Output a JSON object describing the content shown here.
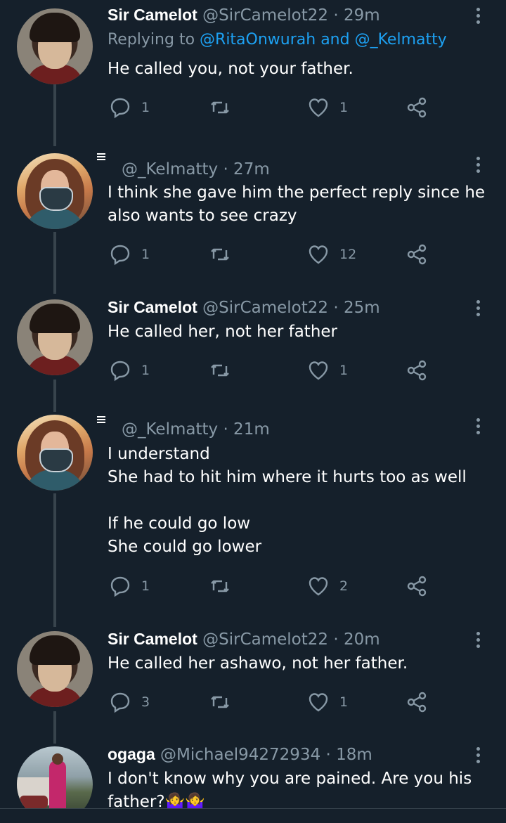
{
  "colors": {
    "background": "#15202b",
    "text": "#ffffff",
    "secondary": "#8899a6",
    "link": "#1da1f2",
    "line": "#38444d"
  },
  "tweets": [
    {
      "name": "Sir Camelot",
      "handle": "@SirCamelot22",
      "time": "· 29m",
      "reply_prefix": "Replying to",
      "reply_mention1": "@RitaOnwurah",
      "reply_and": "and",
      "reply_mention2": "@_Kelmatty",
      "text": "He called you, not your father.",
      "replies": "1",
      "retweets": "",
      "likes": "1"
    },
    {
      "name": "",
      "handle": "@_Kelmatty",
      "time": "· 27m",
      "text": "I think she gave him the perfect reply since he\nalso wants to see crazy",
      "replies": "1",
      "retweets": "",
      "likes": "12"
    },
    {
      "name": "Sir Camelot",
      "handle": "@SirCamelot22",
      "time": "· 25m",
      "text": "He called her, not her father",
      "replies": "1",
      "retweets": "",
      "likes": "1"
    },
    {
      "name": "",
      "handle": "@_Kelmatty",
      "time": "· 21m",
      "text": "I understand\nShe had to hit him where it hurts too as well\n\nIf he could go low\nShe could go lower",
      "replies": "1",
      "retweets": "",
      "likes": "2"
    },
    {
      "name": "Sir Camelot",
      "handle": "@SirCamelot22",
      "time": "· 20m",
      "text": "He called her ashawo, not her father.",
      "replies": "3",
      "retweets": "",
      "likes": "1"
    },
    {
      "name": "ogaga",
      "handle": "@Michael94272934",
      "time": "· 18m",
      "text": "I don't know why you are pained. Are you his\nfather?🤷‍♀️🤷‍♀️",
      "replies": "",
      "retweets": "",
      "likes": ""
    }
  ],
  "icons": {
    "reply": "reply-icon",
    "retweet": "retweet-icon",
    "like": "heart-icon",
    "share": "share-icon",
    "more": "more-vertical-icon",
    "list": "list-icon"
  }
}
